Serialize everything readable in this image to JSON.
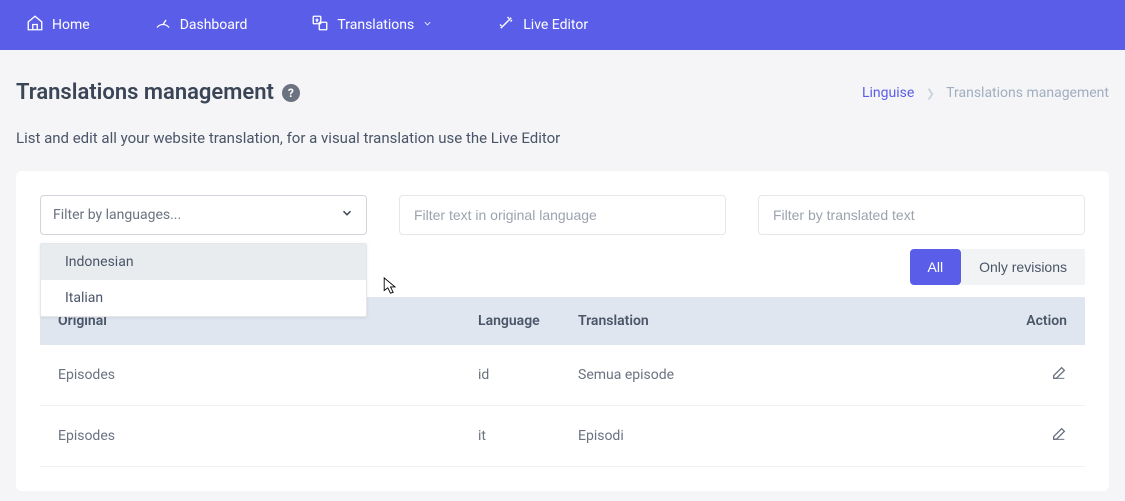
{
  "nav": {
    "home": "Home",
    "dashboard": "Dashboard",
    "translations": "Translations",
    "live_editor": "Live Editor"
  },
  "header": {
    "title": "Translations management",
    "subtitle": "List and edit all your website translation, for a visual translation use the Live Editor"
  },
  "breadcrumb": {
    "root": "Linguise",
    "current": "Translations management"
  },
  "filters": {
    "language_placeholder": "Filter by languages...",
    "original_placeholder": "Filter text in original language",
    "translated_placeholder": "Filter by translated text",
    "dropdown": {
      "opt0": "Indonesian",
      "opt1": "Italian"
    }
  },
  "toggle": {
    "all": "All",
    "revisions": "Only revisions"
  },
  "table": {
    "head": {
      "original": "Original",
      "language": "Language",
      "translation": "Translation",
      "action": "Action"
    },
    "rows": [
      {
        "original": "Episodes",
        "language": "id",
        "translation": "Semua episode"
      },
      {
        "original": "Episodes",
        "language": "it",
        "translation": "Episodi"
      }
    ]
  }
}
